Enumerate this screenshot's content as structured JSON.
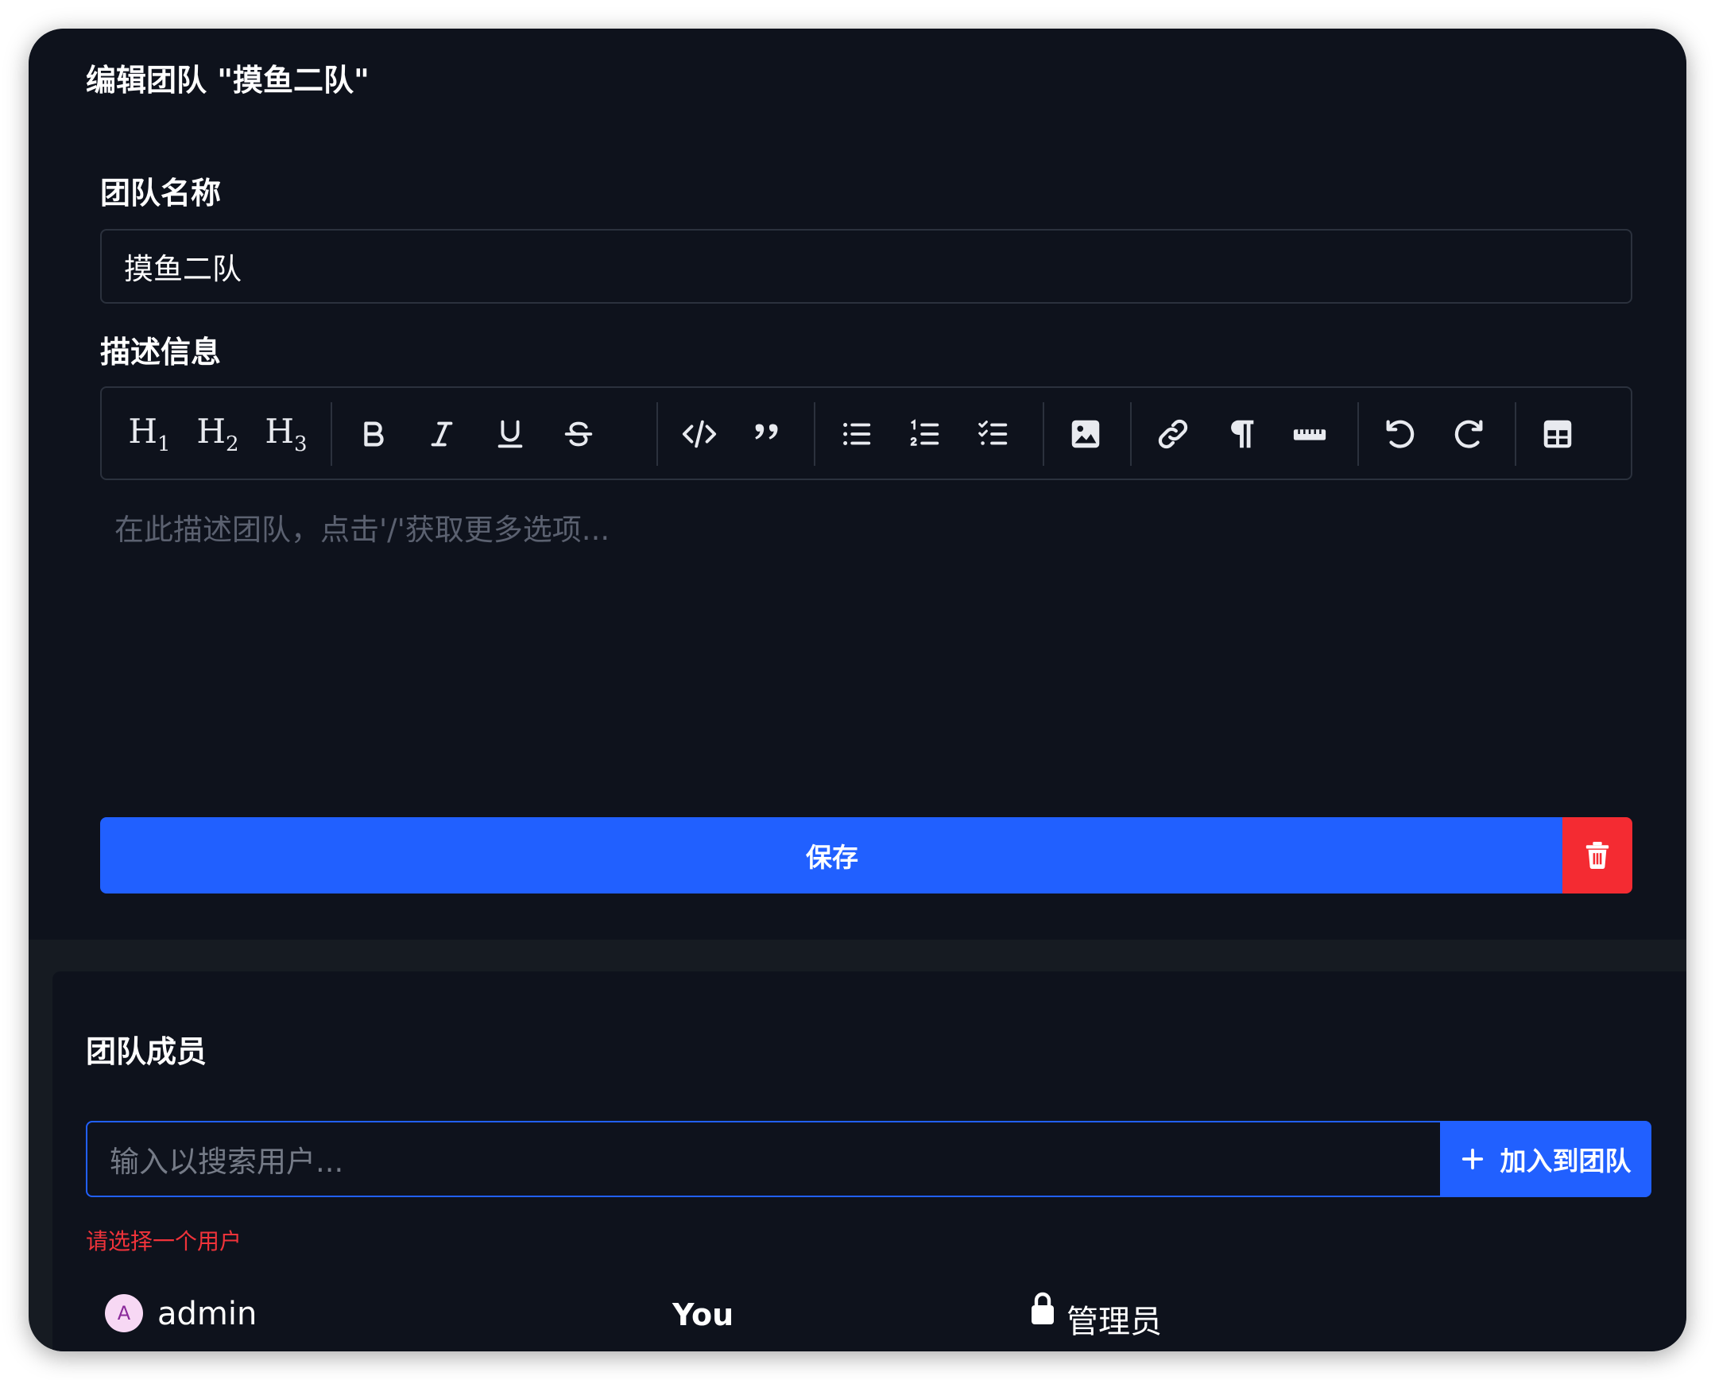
{
  "edit_card": {
    "title": "编辑团队 \"摸鱼二队\"",
    "name_label": "团队名称",
    "name_value": "摸鱼二队",
    "desc_label": "描述信息",
    "desc_placeholder": "在此描述团队，点击'/'获取更多选项...",
    "save_label": "保存"
  },
  "toolbar": {
    "h1": "H",
    "h1_sub": "1",
    "h2": "H",
    "h2_sub": "2",
    "h3": "H",
    "h3_sub": "3",
    "icons": [
      "heading-1-icon",
      "heading-2-icon",
      "heading-3-icon",
      "bold-icon",
      "italic-icon",
      "underline-icon",
      "strikethrough-icon",
      "code-icon",
      "quote-icon",
      "bullet-list-icon",
      "ordered-list-icon",
      "task-list-icon",
      "image-icon",
      "link-icon",
      "paragraph-icon",
      "ruler-icon",
      "undo-icon",
      "redo-icon",
      "table-icon"
    ]
  },
  "members_card": {
    "title": "团队成员",
    "search_placeholder": "输入以搜索用户...",
    "add_label": "加入到团队",
    "error": "请选择一个用户",
    "members": [
      {
        "initial": "A",
        "name": "admin",
        "you": "You",
        "role": "管理员"
      }
    ]
  },
  "colors": {
    "primary": "#2160ff",
    "danger": "#f42b32",
    "background": "#0e121c"
  }
}
